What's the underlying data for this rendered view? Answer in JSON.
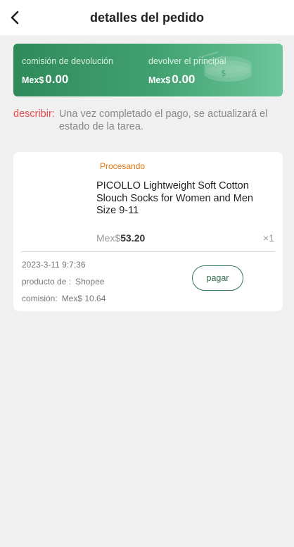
{
  "header": {
    "title": "detalles del pedido"
  },
  "banner": {
    "commission_label": "comisión de devolución",
    "commission_currency": "Mex$",
    "commission_value": "0.00",
    "principal_label": "devolver el principal",
    "principal_currency": "Mex$",
    "principal_value": "0.00"
  },
  "describe": {
    "label": "describir:",
    "text": "Una vez completado el pago, se actualizará el estado de la tarea."
  },
  "order": {
    "status": "Procesando",
    "status_color": "#e8730c",
    "product_name": "PICOLLO Lightweight Soft Cotton Slouch Socks for Women and Men Size 9-11",
    "price_currency": "Mex$",
    "price_value": "53.20",
    "quantity": "×1",
    "date": "2023-3-11 9:7:36",
    "source_label": "producto de :",
    "source_value": "Shopee",
    "commission_label": "comisión:",
    "commission_value": "Mex$ 10.64",
    "pay_label": "pagar"
  },
  "colors": {
    "accent": "#2f8a5a",
    "alert": "#e84b4b"
  }
}
